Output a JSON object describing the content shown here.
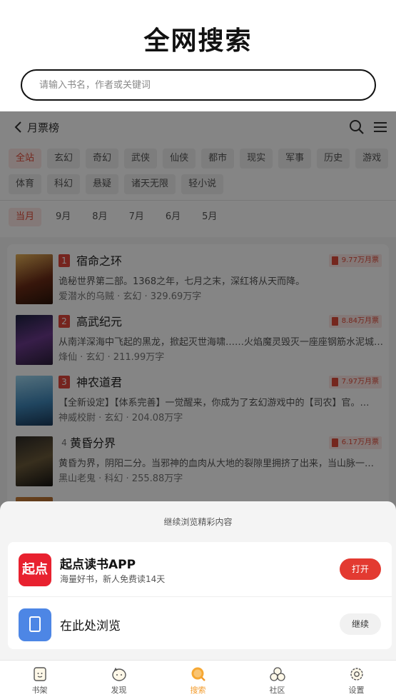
{
  "header": {
    "title": "全网搜索",
    "search_placeholder": "请输入书名，作者或关键词"
  },
  "embedded": {
    "nav_title": "月票榜",
    "categories_row1": [
      "全站",
      "玄幻",
      "奇幻",
      "武侠",
      "仙侠",
      "都市",
      "现实",
      "军事",
      "历史",
      "游戏"
    ],
    "categories_row2": [
      "体育",
      "科幻",
      "悬疑",
      "诸天无限",
      "轻小说"
    ],
    "months": [
      "当月",
      "9月",
      "8月",
      "7月",
      "6月",
      "5月"
    ],
    "books": [
      {
        "rank": "1",
        "title": "宿命之环",
        "tickets": "9.77万月票",
        "desc": "诡秘世界第二部。1368之年，七月之末，深红将从天而降。",
        "meta": "爱潜水的乌贼 · 玄幻 · 329.69万字"
      },
      {
        "rank": "2",
        "title": "高武纪元",
        "tickets": "8.84万月票",
        "desc": "从南洋深海中飞起的黑龙，掀起灭世海啸……火焰魔灵毁灭一座座钢筋水泥城…",
        "meta": "烽仙 · 玄幻 · 211.99万字"
      },
      {
        "rank": "3",
        "title": "神农道君",
        "tickets": "7.97万月票",
        "desc": "【全新设定】【体系完善】一觉醒来，你成为了玄幻游戏中的【司农】官。…",
        "meta": "神威校尉 · 玄幻 · 204.08万字"
      },
      {
        "rank": "4",
        "title": "黄昏分界",
        "tickets": "6.17万月票",
        "desc": "黄昏为界，阴阳二分。当邪神的血肉从大地的裂隙里拥挤了出来，当山脉一…",
        "meta": "黑山老鬼 · 科幻 · 255.88万字"
      }
    ]
  },
  "sheet": {
    "title": "继续浏览精彩内容",
    "app_icon_text": "起点",
    "app_name": "起点读书APP",
    "app_sub": "海量好书，新人免费读14天",
    "open_label": "打开",
    "browse_name": "在此处浏览",
    "continue_label": "继续"
  },
  "tabs": [
    {
      "label": "书架",
      "icon": "bookshelf-icon"
    },
    {
      "label": "发现",
      "icon": "discover-icon"
    },
    {
      "label": "搜索",
      "icon": "search-icon",
      "active": true
    },
    {
      "label": "社区",
      "icon": "community-icon"
    },
    {
      "label": "设置",
      "icon": "settings-icon"
    }
  ],
  "colors": {
    "accent_red": "#e33a31",
    "tab_active": "#f39b2b",
    "browse_blue": "#4d86e5"
  }
}
